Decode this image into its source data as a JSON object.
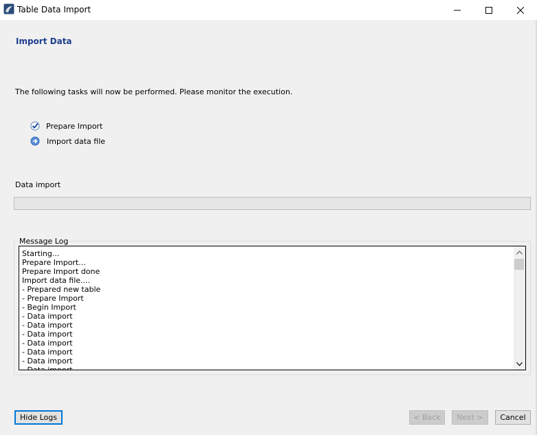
{
  "window": {
    "title": "Table Data Import",
    "app_icon": "mysql-workbench-icon",
    "controls": [
      "minimize-icon",
      "maximize-icon",
      "close-icon"
    ]
  },
  "page": {
    "title": "Import Data",
    "intro": "The following tasks will now be performed. Please monitor the execution."
  },
  "tasks": [
    {
      "label": "Prepare Import",
      "status": "done",
      "icon": "checkmark-icon"
    },
    {
      "label": "Import data file",
      "status": "in-progress",
      "icon": "arrow-right-icon"
    }
  ],
  "progress": {
    "label": "Data import",
    "percent": 0
  },
  "message_log": {
    "legend": "Message Log",
    "lines": [
      "Starting...",
      "Prepare Import...",
      "Prepare Import done",
      "Import data file....",
      "- Prepared new table",
      "- Prepare Import",
      "- Begin Import",
      "- Data import",
      "- Data import",
      "- Data import",
      "- Data import",
      "- Data import",
      "- Data import",
      "- Data import"
    ]
  },
  "buttons": {
    "hide_logs": "Hide Logs",
    "back": "< Back",
    "next": "Next >",
    "cancel": "Cancel"
  },
  "colors": {
    "title_accent": "#1f3f8f",
    "focus_border": "#0078d7",
    "progress_fill": "#06b025"
  }
}
